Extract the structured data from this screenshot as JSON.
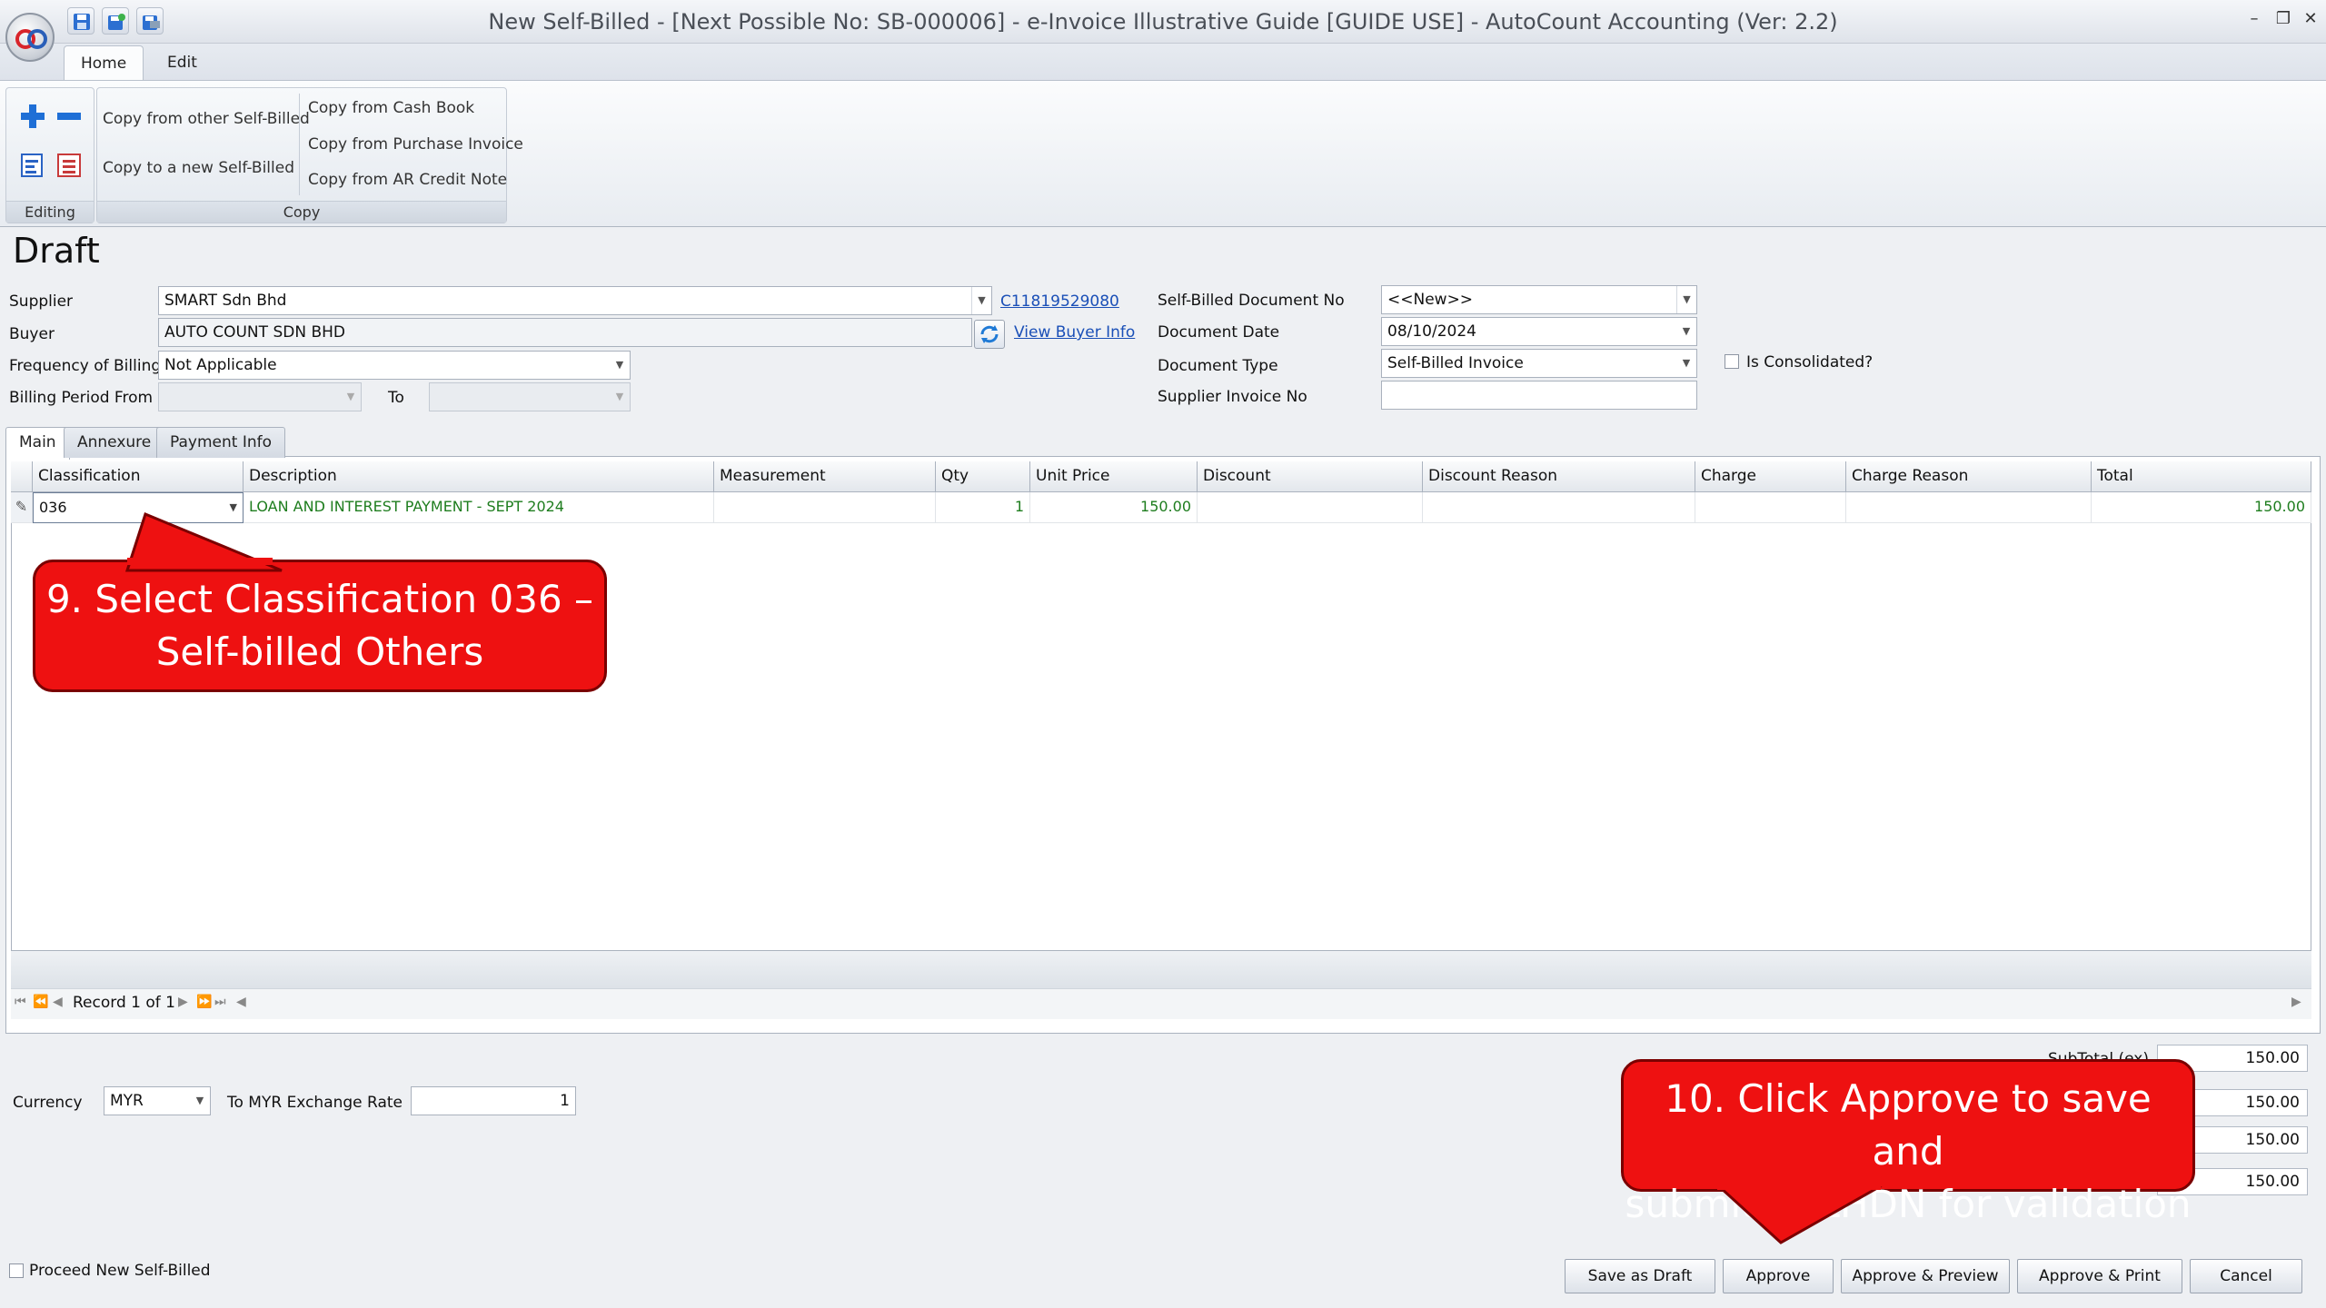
{
  "window": {
    "title": "New Self-Billed - [Next Possible No: SB-000006] - e-Invoice Illustrative Guide [GUIDE USE] - AutoCount Accounting (Ver: 2.2)",
    "minimize": "–",
    "restore": "❐",
    "close": "✕"
  },
  "ribbon": {
    "tabs": [
      "Home",
      "Edit"
    ],
    "groups": {
      "editing": {
        "label": "Editing"
      },
      "copy": {
        "label": "Copy",
        "buttons": [
          "Copy from other Self-Billed",
          "Copy to a new Self-Billed",
          "Copy from Cash Book",
          "Copy from Purchase Invoice",
          "Copy from AR Credit Note"
        ]
      }
    }
  },
  "status": "Draft",
  "form": {
    "supplier_label": "Supplier",
    "supplier_value": "SMART Sdn Bhd",
    "supplier_tin": "C11819529080",
    "buyer_label": "Buyer",
    "buyer_value": "AUTO COUNT SDN BHD",
    "view_buyer_info": "View Buyer Info",
    "frequency_label": "Frequency of Billing",
    "frequency_value": "Not Applicable",
    "billing_period_from_label": "Billing Period From",
    "billing_period_to_label": "To",
    "doc_no_label": "Self-Billed Document No",
    "doc_no_value": "<<New>>",
    "doc_date_label": "Document Date",
    "doc_date_value": "08/10/2024",
    "doc_type_label": "Document Type",
    "doc_type_value": "Self-Billed Invoice",
    "supplier_inv_label": "Supplier Invoice No",
    "supplier_inv_value": "",
    "consolidated_label": "Is Consolidated?"
  },
  "detail_tabs": [
    "Main",
    "Annexure",
    "Payment Info"
  ],
  "grid": {
    "columns": [
      "Classification",
      "Description",
      "Measurement",
      "Qty",
      "Unit Price",
      "Discount",
      "Discount Reason",
      "Charge",
      "Charge Reason",
      "Total"
    ],
    "rows": [
      {
        "classification": "036",
        "description": "LOAN AND INTEREST PAYMENT - SEPT 2024",
        "measurement": "",
        "qty": "1",
        "unit_price": "150.00",
        "discount": "",
        "discount_reason": "",
        "charge": "",
        "charge_reason": "",
        "total": "150.00"
      }
    ],
    "record_text": "Record 1 of 1"
  },
  "footer": {
    "currency_label": "Currency",
    "currency_value": "MYR",
    "rate_label": "To MYR Exchange Rate",
    "rate_value": "1",
    "subtotal_label": "SubTotal (ex)",
    "totals": [
      "150.00",
      "150.00",
      "150.00",
      "150.00"
    ],
    "proceed_label": "Proceed New Self-Billed"
  },
  "buttons": {
    "save_draft": "Save as Draft",
    "approve": "Approve",
    "approve_preview": "Approve & Preview",
    "approve_print": "Approve & Print",
    "cancel": "Cancel"
  },
  "callouts": {
    "step9": [
      "9. Select Classification 036 –",
      "Self-billed Others"
    ],
    "step10": [
      "10. Click Approve to save and",
      "submit to LHDN for validation"
    ]
  },
  "colors": {
    "callout": "#ee1111",
    "grid_text": "#1e7d1e",
    "link": "#1a4fb7"
  }
}
